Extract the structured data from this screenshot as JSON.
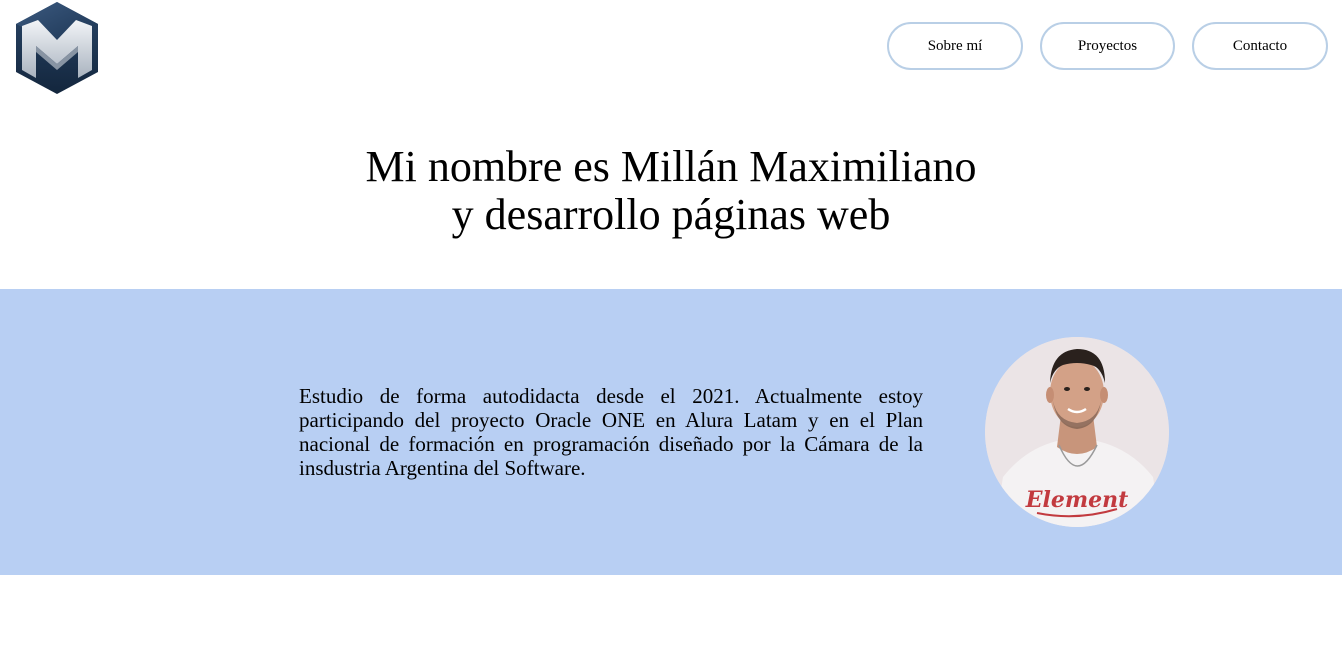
{
  "logo": {
    "letter": "M",
    "brand_color": "#1f3b5c"
  },
  "nav": {
    "items": [
      {
        "label": "Sobre mí"
      },
      {
        "label": "Proyectos"
      },
      {
        "label": "Contacto"
      }
    ],
    "border_color": "#b9cfe6"
  },
  "hero": {
    "line1": "Mi nombre es Millán Maximiliano",
    "line2": "y desarrollo páginas web"
  },
  "about": {
    "background": "#b8cff3",
    "text": "Estudio de forma autodidacta desde el 2021. Actualmente estoy participando del proyecto Oracle ONE en Alura Latam y en el Plan nacional de formación en programación diseñado por la Cámara de la insdustria Argentina del Software.",
    "photo_shirt_text": "Element"
  }
}
